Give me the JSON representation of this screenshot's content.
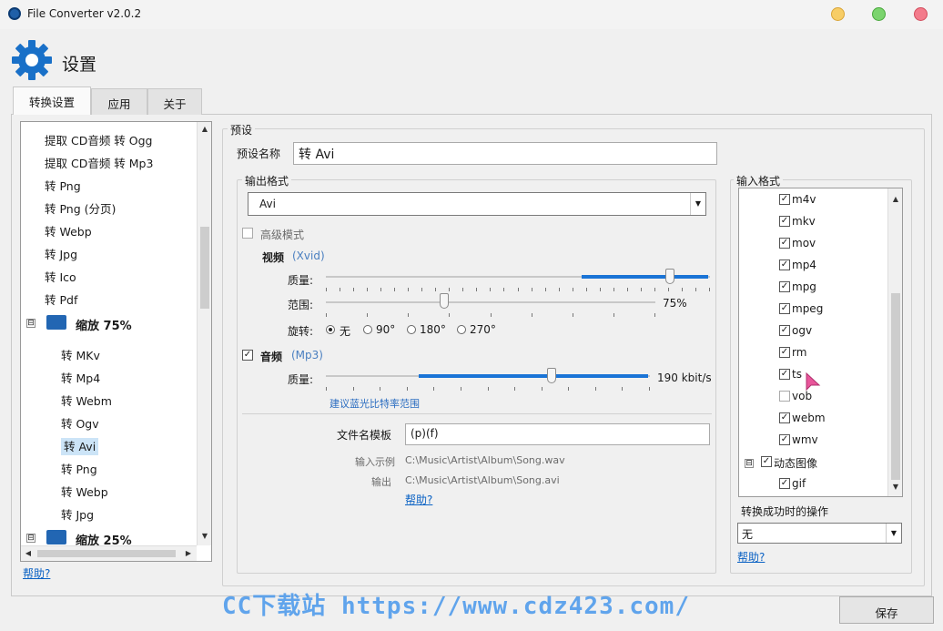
{
  "window": {
    "title": "File Converter v2.0.2"
  },
  "header": {
    "title": "设置"
  },
  "tabs": [
    {
      "label": "转换设置"
    },
    {
      "label": "应用"
    },
    {
      "label": "关于"
    }
  ],
  "presets": {
    "items": [
      "提取 CD音频 转 Ogg",
      "提取 CD音频 转 Mp3",
      "转 Png",
      "转 Png (分页)",
      "转 Webp",
      "转 Jpg",
      "转 Ico",
      "转 Pdf"
    ],
    "group1": {
      "label": "缩放 75%",
      "expander": "⊟"
    },
    "group1_items": [
      "转 MKv",
      "转 Mp4",
      "转 Webm",
      "转 Ogv",
      "转 Avi",
      "转 Png",
      "转 Webp",
      "转 Jpg"
    ],
    "group2": {
      "label": "缩放 25%",
      "expander": "⊟"
    },
    "selected": "转 Avi"
  },
  "help_label": "帮助?",
  "preset_box": {
    "title": "预设",
    "name_label": "预设名称",
    "name_value": "转 Avi"
  },
  "output": {
    "title": "输出格式",
    "format": "Avi",
    "advanced_label": "高级模式",
    "video": {
      "label": "视频",
      "codec": "(Xvid)",
      "quality_label": "质量:",
      "quality": 0.93,
      "scale_label": "范围:",
      "scale_value": "75%",
      "scale": 0.35,
      "rotate_label": "旋转:",
      "rotations": [
        "无",
        "90°",
        "180°",
        "270°"
      ],
      "rotation_selected": "无"
    },
    "audio": {
      "label": "音频",
      "codec": "(Mp3)",
      "enabled": true,
      "quality_label": "质量:",
      "quality_value": "190 kbit/s",
      "quality": 0.69,
      "hint": "建议蓝光比特率范围"
    },
    "filename_label": "文件名模板",
    "filename_value": "(p)(f)",
    "example_label": "输入示例",
    "example_value": "C:\\Music\\Artist\\Album\\Song.wav",
    "output_label": "输出",
    "output_value": "C:\\Music\\Artist\\Album\\Song.avi"
  },
  "input_formats": {
    "title": "输入格式",
    "items": [
      {
        "name": "m4v",
        "checked": true
      },
      {
        "name": "mkv",
        "checked": true
      },
      {
        "name": "mov",
        "checked": true
      },
      {
        "name": "mp4",
        "checked": true
      },
      {
        "name": "mpg",
        "checked": true
      },
      {
        "name": "mpeg",
        "checked": true
      },
      {
        "name": "ogv",
        "checked": true
      },
      {
        "name": "rm",
        "checked": true
      },
      {
        "name": "ts",
        "checked": true
      },
      {
        "name": "vob",
        "checked": false
      },
      {
        "name": "webm",
        "checked": true
      },
      {
        "name": "wmv",
        "checked": true
      }
    ],
    "group": {
      "label": "动态图像",
      "expander": "⊟"
    },
    "group_items": [
      {
        "name": "gif",
        "checked": true
      }
    ]
  },
  "after_action": {
    "label": "转换成功时的操作",
    "value": "无"
  },
  "save_label": "保存",
  "watermark": "CC下载站 https://www.cdz423.com/"
}
